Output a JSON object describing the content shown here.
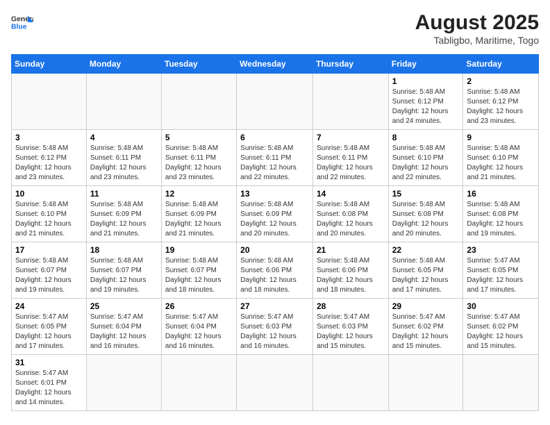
{
  "header": {
    "logo_general": "General",
    "logo_blue": "Blue",
    "title": "August 2025",
    "subtitle": "Tabligbo, Maritime, Togo"
  },
  "weekdays": [
    "Sunday",
    "Monday",
    "Tuesday",
    "Wednesday",
    "Thursday",
    "Friday",
    "Saturday"
  ],
  "weeks": [
    [
      {
        "day": "",
        "info": ""
      },
      {
        "day": "",
        "info": ""
      },
      {
        "day": "",
        "info": ""
      },
      {
        "day": "",
        "info": ""
      },
      {
        "day": "",
        "info": ""
      },
      {
        "day": "1",
        "info": "Sunrise: 5:48 AM\nSunset: 6:12 PM\nDaylight: 12 hours and 24 minutes."
      },
      {
        "day": "2",
        "info": "Sunrise: 5:48 AM\nSunset: 6:12 PM\nDaylight: 12 hours and 23 minutes."
      }
    ],
    [
      {
        "day": "3",
        "info": "Sunrise: 5:48 AM\nSunset: 6:12 PM\nDaylight: 12 hours and 23 minutes."
      },
      {
        "day": "4",
        "info": "Sunrise: 5:48 AM\nSunset: 6:11 PM\nDaylight: 12 hours and 23 minutes."
      },
      {
        "day": "5",
        "info": "Sunrise: 5:48 AM\nSunset: 6:11 PM\nDaylight: 12 hours and 23 minutes."
      },
      {
        "day": "6",
        "info": "Sunrise: 5:48 AM\nSunset: 6:11 PM\nDaylight: 12 hours and 22 minutes."
      },
      {
        "day": "7",
        "info": "Sunrise: 5:48 AM\nSunset: 6:11 PM\nDaylight: 12 hours and 22 minutes."
      },
      {
        "day": "8",
        "info": "Sunrise: 5:48 AM\nSunset: 6:10 PM\nDaylight: 12 hours and 22 minutes."
      },
      {
        "day": "9",
        "info": "Sunrise: 5:48 AM\nSunset: 6:10 PM\nDaylight: 12 hours and 21 minutes."
      }
    ],
    [
      {
        "day": "10",
        "info": "Sunrise: 5:48 AM\nSunset: 6:10 PM\nDaylight: 12 hours and 21 minutes."
      },
      {
        "day": "11",
        "info": "Sunrise: 5:48 AM\nSunset: 6:09 PM\nDaylight: 12 hours and 21 minutes."
      },
      {
        "day": "12",
        "info": "Sunrise: 5:48 AM\nSunset: 6:09 PM\nDaylight: 12 hours and 21 minutes."
      },
      {
        "day": "13",
        "info": "Sunrise: 5:48 AM\nSunset: 6:09 PM\nDaylight: 12 hours and 20 minutes."
      },
      {
        "day": "14",
        "info": "Sunrise: 5:48 AM\nSunset: 6:08 PM\nDaylight: 12 hours and 20 minutes."
      },
      {
        "day": "15",
        "info": "Sunrise: 5:48 AM\nSunset: 6:08 PM\nDaylight: 12 hours and 20 minutes."
      },
      {
        "day": "16",
        "info": "Sunrise: 5:48 AM\nSunset: 6:08 PM\nDaylight: 12 hours and 19 minutes."
      }
    ],
    [
      {
        "day": "17",
        "info": "Sunrise: 5:48 AM\nSunset: 6:07 PM\nDaylight: 12 hours and 19 minutes."
      },
      {
        "day": "18",
        "info": "Sunrise: 5:48 AM\nSunset: 6:07 PM\nDaylight: 12 hours and 19 minutes."
      },
      {
        "day": "19",
        "info": "Sunrise: 5:48 AM\nSunset: 6:07 PM\nDaylight: 12 hours and 18 minutes."
      },
      {
        "day": "20",
        "info": "Sunrise: 5:48 AM\nSunset: 6:06 PM\nDaylight: 12 hours and 18 minutes."
      },
      {
        "day": "21",
        "info": "Sunrise: 5:48 AM\nSunset: 6:06 PM\nDaylight: 12 hours and 18 minutes."
      },
      {
        "day": "22",
        "info": "Sunrise: 5:48 AM\nSunset: 6:05 PM\nDaylight: 12 hours and 17 minutes."
      },
      {
        "day": "23",
        "info": "Sunrise: 5:47 AM\nSunset: 6:05 PM\nDaylight: 12 hours and 17 minutes."
      }
    ],
    [
      {
        "day": "24",
        "info": "Sunrise: 5:47 AM\nSunset: 6:05 PM\nDaylight: 12 hours and 17 minutes."
      },
      {
        "day": "25",
        "info": "Sunrise: 5:47 AM\nSunset: 6:04 PM\nDaylight: 12 hours and 16 minutes."
      },
      {
        "day": "26",
        "info": "Sunrise: 5:47 AM\nSunset: 6:04 PM\nDaylight: 12 hours and 16 minutes."
      },
      {
        "day": "27",
        "info": "Sunrise: 5:47 AM\nSunset: 6:03 PM\nDaylight: 12 hours and 16 minutes."
      },
      {
        "day": "28",
        "info": "Sunrise: 5:47 AM\nSunset: 6:03 PM\nDaylight: 12 hours and 15 minutes."
      },
      {
        "day": "29",
        "info": "Sunrise: 5:47 AM\nSunset: 6:02 PM\nDaylight: 12 hours and 15 minutes."
      },
      {
        "day": "30",
        "info": "Sunrise: 5:47 AM\nSunset: 6:02 PM\nDaylight: 12 hours and 15 minutes."
      }
    ],
    [
      {
        "day": "31",
        "info": "Sunrise: 5:47 AM\nSunset: 6:01 PM\nDaylight: 12 hours and 14 minutes."
      },
      {
        "day": "",
        "info": ""
      },
      {
        "day": "",
        "info": ""
      },
      {
        "day": "",
        "info": ""
      },
      {
        "day": "",
        "info": ""
      },
      {
        "day": "",
        "info": ""
      },
      {
        "day": "",
        "info": ""
      }
    ]
  ]
}
